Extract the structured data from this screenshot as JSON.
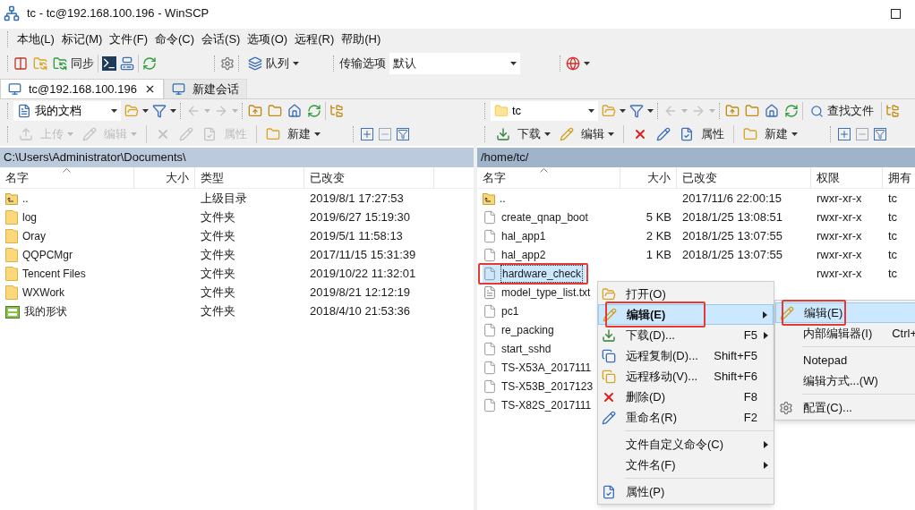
{
  "window": {
    "title": "tc - tc@192.168.100.196 - WinSCP"
  },
  "menu_bar": [
    "本地(L)",
    "标记(M)",
    "文件(F)",
    "命令(C)",
    "会话(S)",
    "选项(O)",
    "远程(R)",
    "帮助(H)"
  ],
  "toolbar": {
    "sync_label": "同步",
    "queue_label": "队列",
    "transfer_label": "传输选项",
    "transfer_value": "默认"
  },
  "tabs": [
    {
      "label": "tc@192.168.100.196",
      "selected": true,
      "closable": true
    },
    {
      "label": "新建会话",
      "selected": false,
      "closable": false
    }
  ],
  "local": {
    "location": "我的文档",
    "path": "C:\\Users\\Administrator\\Documents\\",
    "buttons": [
      {
        "kind": "labeled",
        "label": "上传",
        "disabled": true,
        "dropdown": true
      },
      {
        "kind": "labeled",
        "label": "编辑",
        "disabled": true,
        "dropdown": true
      },
      {
        "kind": "icon",
        "disabled": true
      },
      {
        "kind": "icon",
        "disabled": true
      },
      {
        "kind": "labeled",
        "label": "属性",
        "disabled": true,
        "dropdown": false
      },
      {
        "kind": "labeled",
        "label": "新建",
        "disabled": false,
        "dropdown": true
      }
    ],
    "columns": [
      "名字",
      "大小",
      "类型",
      "已改变"
    ],
    "rows": [
      {
        "kind": "parent",
        "name": "..",
        "type": "上级目录",
        "modified": "2019/8/1  17:27:53",
        "selected": false,
        "marked": false
      },
      {
        "kind": "folder",
        "name": "log",
        "type": "文件夹",
        "modified": "2019/6/27  15:19:30",
        "selected": false,
        "marked": false
      },
      {
        "kind": "folder",
        "name": "Oray",
        "type": "文件夹",
        "modified": "2019/5/1  11:58:13",
        "selected": false,
        "marked": false
      },
      {
        "kind": "folder",
        "name": "QQPCMgr",
        "type": "文件夹",
        "modified": "2017/11/15  15:31:39",
        "selected": false,
        "marked": false
      },
      {
        "kind": "folder",
        "name": "Tencent Files",
        "type": "文件夹",
        "modified": "2019/10/22  11:32:01",
        "selected": false,
        "marked": false
      },
      {
        "kind": "folder",
        "name": "WXWork",
        "type": "文件夹",
        "modified": "2019/8/21  12:12:19",
        "selected": false,
        "marked": false
      },
      {
        "kind": "special",
        "name": "我的形状",
        "type": "文件夹",
        "modified": "2018/4/10  21:53:36",
        "selected": false,
        "marked": false
      }
    ]
  },
  "remote": {
    "location": "tc",
    "find_label": "查找文件",
    "path": "/home/tc/",
    "buttons": [
      {
        "kind": "labeled",
        "label": "下载",
        "disabled": false,
        "dropdown": true
      },
      {
        "kind": "labeled",
        "label": "编辑",
        "disabled": false,
        "dropdown": true
      },
      {
        "kind": "icon",
        "disabled": false
      },
      {
        "kind": "icon",
        "disabled": false
      },
      {
        "kind": "labeled",
        "label": "属性",
        "disabled": false,
        "dropdown": false
      },
      {
        "kind": "labeled",
        "label": "新建",
        "disabled": false,
        "dropdown": true
      }
    ],
    "columns": [
      "名字",
      "大小",
      "已改变",
      "权限",
      "拥有"
    ],
    "rows": [
      {
        "kind": "parent",
        "name": "..",
        "modified": "2017/11/6 22:00:15",
        "permissions": "rwxr-xr-x",
        "owner": "tc",
        "selected": false,
        "marked": false
      },
      {
        "kind": "file",
        "name": "create_qnap_boot",
        "size": "5 KB",
        "modified": "2018/1/25 13:08:51",
        "permissions": "rwxr-xr-x",
        "owner": "tc",
        "selected": false,
        "marked": false
      },
      {
        "kind": "file",
        "name": "hal_app1",
        "size": "2 KB",
        "modified": "2018/1/25 13:07:55",
        "permissions": "rwxr-xr-x",
        "owner": "tc",
        "selected": false,
        "marked": false
      },
      {
        "kind": "file",
        "name": "hal_app2",
        "size": "1 KB",
        "modified": "2018/1/25 13:07:55",
        "permissions": "rwxr-xr-x",
        "owner": "tc",
        "selected": false,
        "marked": false
      },
      {
        "kind": "file",
        "name": "hardware_check",
        "permissions": "rwxr-xr-x",
        "owner": "tc",
        "selected": true,
        "marked": true
      },
      {
        "kind": "text",
        "name": "model_type_list.txt",
        "selected": false,
        "marked": false
      },
      {
        "kind": "file",
        "name": "pc1",
        "selected": false,
        "marked": false
      },
      {
        "kind": "file",
        "name": "re_packing",
        "selected": false,
        "marked": false
      },
      {
        "kind": "file",
        "name": "start_sshd",
        "selected": false,
        "marked": false
      },
      {
        "kind": "file",
        "name": "TS-X53A_2017111",
        "selected": false,
        "marked": false
      },
      {
        "kind": "file",
        "name": "TS-X53B_2017123",
        "selected": false,
        "marked": false
      },
      {
        "kind": "file",
        "name": "TS-X82S_2017111",
        "selected": false,
        "marked": false
      }
    ]
  },
  "context_menu": {
    "items": [
      {
        "kind": "item",
        "label": "打开(O)",
        "bold": false,
        "submenu": false,
        "highlighted": false,
        "marked": false
      },
      {
        "kind": "item",
        "label": "编辑(E)",
        "bold": true,
        "submenu": true,
        "highlighted": true,
        "marked": true
      },
      {
        "kind": "item",
        "label": "下载(D)...",
        "shortcut": "F5",
        "bold": false,
        "submenu": true,
        "highlighted": false,
        "marked": false
      },
      {
        "kind": "item",
        "label": "远程复制(D)...",
        "shortcut": "Shift+F5",
        "bold": false,
        "submenu": false,
        "highlighted": false,
        "marked": false
      },
      {
        "kind": "item",
        "label": "远程移动(V)...",
        "shortcut": "Shift+F6",
        "bold": false,
        "submenu": false,
        "highlighted": false,
        "marked": false
      },
      {
        "kind": "item",
        "label": "删除(D)",
        "shortcut": "F8",
        "bold": false,
        "submenu": false,
        "highlighted": false,
        "marked": false
      },
      {
        "kind": "item",
        "label": "重命名(R)",
        "shortcut": "F2",
        "bold": false,
        "submenu": false,
        "highlighted": false,
        "marked": false
      },
      {
        "kind": "separator"
      },
      {
        "kind": "item",
        "label": "文件自定义命令(C)",
        "bold": false,
        "submenu": true,
        "highlighted": false,
        "marked": false
      },
      {
        "kind": "item",
        "label": "文件名(F)",
        "bold": false,
        "submenu": true,
        "highlighted": false,
        "marked": false
      },
      {
        "kind": "separator"
      },
      {
        "kind": "item",
        "label": "属性(P)",
        "bold": false,
        "submenu": false,
        "highlighted": false,
        "marked": false
      }
    ]
  },
  "submenu": {
    "items": [
      {
        "kind": "item",
        "label": "编辑(E)",
        "highlighted": true,
        "marked": true
      },
      {
        "kind": "item",
        "label": "内部编辑器(I)",
        "shortcut": "Ctrl+",
        "highlighted": false,
        "marked": false
      },
      {
        "kind": "separator"
      },
      {
        "kind": "item",
        "label": "Notepad",
        "highlighted": false,
        "marked": false
      },
      {
        "kind": "item",
        "label": "编辑方式...(W)",
        "highlighted": false,
        "marked": false
      },
      {
        "kind": "separator"
      },
      {
        "kind": "item",
        "label": "配置(C)...",
        "highlighted": false,
        "marked": false
      }
    ]
  }
}
